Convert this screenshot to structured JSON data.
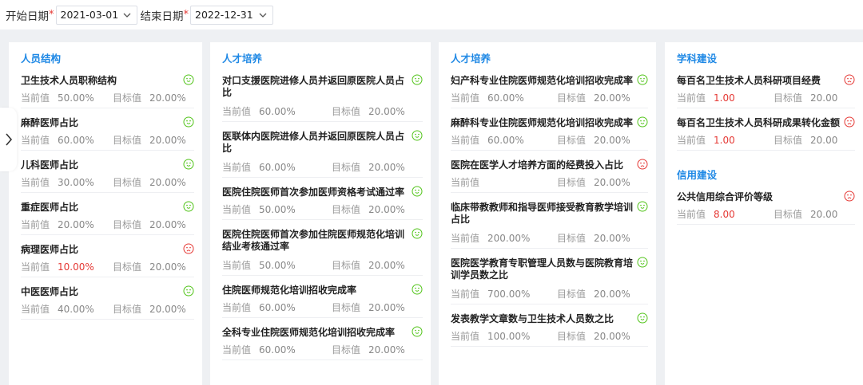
{
  "filters": {
    "start_label": "开始日期",
    "start_value": "2021-03-01",
    "end_label": "结束日期",
    "end_value": "2022-12-31",
    "required_mark": "*"
  },
  "labels": {
    "current": "当前值",
    "target": "目标值"
  },
  "colors": {
    "good": "#52c41a",
    "bad": "#e53935",
    "accent": "#1e88e5"
  },
  "columns": [
    {
      "sections": [
        {
          "title": "人员结构",
          "items": [
            {
              "name": "卫生技术人员职称结构",
              "current": "50.00%",
              "target": "20.00%",
              "status": "good"
            },
            {
              "name": "麻醉医师占比",
              "current": "60.00%",
              "target": "20.00%",
              "status": "good"
            },
            {
              "name": "儿科医师占比",
              "current": "30.00%",
              "target": "20.00%",
              "status": "good"
            },
            {
              "name": "重症医师占比",
              "current": "20.00%",
              "target": "20.00%",
              "status": "good"
            },
            {
              "name": "病理医师占比",
              "current": "10.00%",
              "target": "20.00%",
              "status": "bad"
            },
            {
              "name": "中医医师占比",
              "current": "40.00%",
              "target": "20.00%",
              "status": "good"
            }
          ]
        }
      ]
    },
    {
      "sections": [
        {
          "title": "人才培养",
          "items": [
            {
              "name": "对口支援医院进修人员并返回原医院人员占比",
              "current": "60.00%",
              "target": "20.00%",
              "status": "good"
            },
            {
              "name": "医联体内医院进修人员并返回原医院人员占比",
              "current": "60.00%",
              "target": "20.00%",
              "status": "good"
            },
            {
              "name": "医院住院医师首次参加医师资格考试通过率",
              "current": "50.00%",
              "target": "20.00%",
              "status": "good"
            },
            {
              "name": "医院住院医师首次参加住院医师规范化培训结业考核通过率",
              "current": "50.00%",
              "target": "20.00%",
              "status": "good"
            },
            {
              "name": "住院医师规范化培训招收完成率",
              "current": "60.00%",
              "target": "20.00%",
              "status": "good"
            },
            {
              "name": "全科专业住院医师规范化培训招收完成率",
              "current": "60.00%",
              "target": "20.00%",
              "status": "good"
            }
          ]
        }
      ]
    },
    {
      "sections": [
        {
          "title": "人才培养",
          "items": [
            {
              "name": "妇产科专业住院医师规范化培训招收完成率",
              "current": "60.00%",
              "target": "20.00%",
              "status": "good"
            },
            {
              "name": "麻醉科专业住院医师规范化培训招收完成率",
              "current": "60.00%",
              "target": "20.00%",
              "status": "good"
            },
            {
              "name": "医院在医学人才培养方面的经费投入占比",
              "current": "",
              "target": "20.00%",
              "status": "bad"
            },
            {
              "name": "临床带教教师和指导医师接受教育教学培训占比",
              "current": "200.00%",
              "target": "20.00%",
              "status": "good"
            },
            {
              "name": "医院医学教育专职管理人员数与医院教育培训学员数之比",
              "current": "700.00%",
              "target": "20.00%",
              "status": "good"
            },
            {
              "name": "发表教学文章数与卫生技术人员数之比",
              "current": "100.00%",
              "target": "20.00%",
              "status": "good"
            }
          ]
        }
      ]
    },
    {
      "sections": [
        {
          "title": "学科建设",
          "items": [
            {
              "name": "每百名卫生技术人员科研项目经费",
              "current": "1.00",
              "target": "20.00",
              "status": "bad"
            },
            {
              "name": "每百名卫生技术人员科研成果转化金额",
              "current": "1.00",
              "target": "20.00",
              "status": "bad"
            }
          ]
        },
        {
          "title": "信用建设",
          "items": [
            {
              "name": "公共信用综合评价等级",
              "current": "8.00",
              "target": "20.00",
              "status": "bad"
            }
          ]
        }
      ]
    }
  ]
}
